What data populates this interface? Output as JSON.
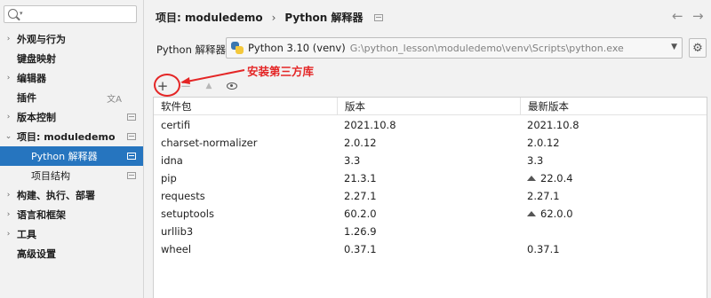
{
  "search": {
    "placeholder": ""
  },
  "sidebar": {
    "items": [
      {
        "label": "外观与行为",
        "expandable": true
      },
      {
        "label": "键盘映射",
        "expandable": false
      },
      {
        "label": "编辑器",
        "expandable": true
      },
      {
        "label": "插件",
        "expandable": false,
        "icon": "translate-icon"
      },
      {
        "label": "版本控制",
        "expandable": true
      },
      {
        "label": "项目: moduledemo",
        "expandable": true,
        "expanded": true
      },
      {
        "label": "Python 解释器",
        "sub": true,
        "selected": true
      },
      {
        "label": "项目结构",
        "sub": true
      },
      {
        "label": "构建、执行、部署",
        "expandable": true
      },
      {
        "label": "语言和框架",
        "expandable": true
      },
      {
        "label": "工具",
        "expandable": true
      },
      {
        "label": "高级设置",
        "expandable": false
      }
    ]
  },
  "header": {
    "breadcrumb_project": "项目: moduledemo",
    "breadcrumb_separator": "›",
    "breadcrumb_page": "Python 解释器",
    "back_icon": "arrow-left-icon",
    "forward_icon": "arrow-right-icon"
  },
  "interpreter": {
    "label": "Python 解释器:",
    "name": "Python 3.10 (venv)",
    "path": "G:\\python_lesson\\moduledemo\\venv\\Scripts\\python.exe"
  },
  "annotation": {
    "text": "安装第三方库",
    "color": "#e42626"
  },
  "toolbar": {
    "add_icon": "+",
    "remove_icon": "−",
    "upgrade_icon": "▲"
  },
  "table": {
    "columns": [
      "软件包",
      "版本",
      "最新版本"
    ],
    "rows": [
      {
        "package": "certifi",
        "version": "2021.10.8",
        "latest": "2021.10.8",
        "upgrade": false
      },
      {
        "package": "charset-normalizer",
        "version": "2.0.12",
        "latest": "2.0.12",
        "upgrade": false
      },
      {
        "package": "idna",
        "version": "3.3",
        "latest": "3.3",
        "upgrade": false
      },
      {
        "package": "pip",
        "version": "21.3.1",
        "latest": "22.0.4",
        "upgrade": true
      },
      {
        "package": "requests",
        "version": "2.27.1",
        "latest": "2.27.1",
        "upgrade": false
      },
      {
        "package": "setuptools",
        "version": "60.2.0",
        "latest": "62.0.0",
        "upgrade": true
      },
      {
        "package": "urllib3",
        "version": "1.26.9",
        "latest": "",
        "upgrade": false
      },
      {
        "package": "wheel",
        "version": "0.37.1",
        "latest": "0.37.1",
        "upgrade": false
      }
    ]
  },
  "colors": {
    "accent": "#2675bf",
    "annotation": "#e42626"
  }
}
